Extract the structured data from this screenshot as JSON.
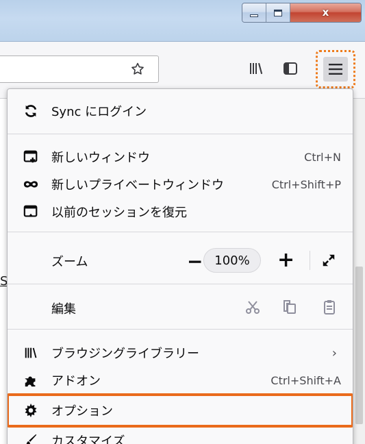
{
  "window": {
    "buttons": {
      "minimize": "minimize",
      "maximize": "maximize",
      "close": "x"
    }
  },
  "toolbar": {
    "icons": [
      "star-icon",
      "library-icon",
      "sidebar-icon",
      "hamburger-menu-icon"
    ]
  },
  "page": {
    "link_fragment": "S"
  },
  "app_menu": {
    "sync_label": "Sync にログイン",
    "new_window": {
      "label": "新しいウィンドウ",
      "shortcut": "Ctrl+N"
    },
    "private_window": {
      "label": "新しいプライベートウィンドウ",
      "shortcut": "Ctrl+Shift+P"
    },
    "restore_session": {
      "label": "以前のセッションを復元"
    },
    "zoom": {
      "label": "ズーム",
      "minus": "−",
      "level": "100%",
      "plus": "+"
    },
    "edit": {
      "label": "編集"
    },
    "library": {
      "label": "ブラウジングライブラリー",
      "arrow": "›"
    },
    "addons": {
      "label": "アドオン",
      "shortcut": "Ctrl+Shift+A"
    },
    "options": {
      "label": "オプション"
    },
    "customize": {
      "label": "カスタマイズ"
    }
  },
  "colors": {
    "highlight": "#ea6b1c",
    "menu_bg": "#f9f9fa",
    "titlebar": "#c6daf0"
  }
}
